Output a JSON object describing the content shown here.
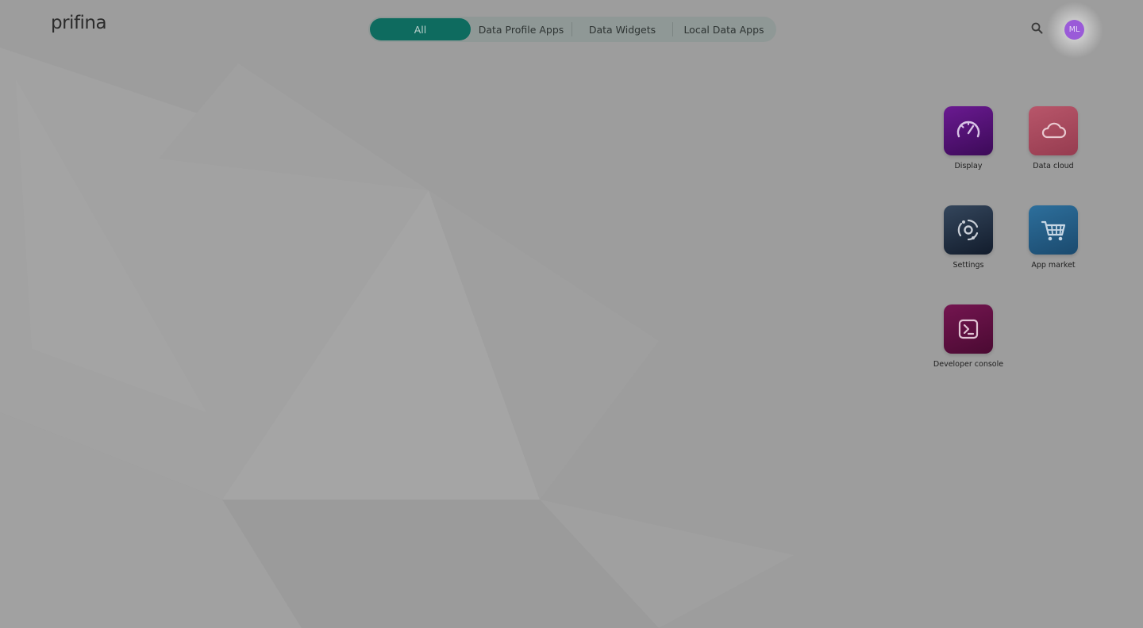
{
  "header": {
    "logo": "prifina",
    "tabs": [
      {
        "label": "All",
        "active": true
      },
      {
        "label": "Data Profile Apps",
        "active": false
      },
      {
        "label": "Data Widgets",
        "active": false
      },
      {
        "label": "Local Data Apps",
        "active": false
      }
    ],
    "search_icon": "search-icon",
    "avatar_initials": "ML"
  },
  "apps": [
    {
      "label": "Display",
      "icon": "speedometer-icon",
      "color": "#4f1070"
    },
    {
      "label": "Data cloud",
      "icon": "cloud-icon",
      "color": "#a84a5c"
    },
    {
      "label": "Settings",
      "icon": "settings-gear-icon",
      "color": "#1f2f44"
    },
    {
      "label": "App market",
      "icon": "shopping-cart-icon",
      "color": "#23597f"
    },
    {
      "label": "Developer console",
      "icon": "terminal-icon",
      "color": "#5e0e3d"
    }
  ],
  "colors": {
    "active_tab": "#0e6b5f",
    "avatar": "#9a5ad8"
  }
}
